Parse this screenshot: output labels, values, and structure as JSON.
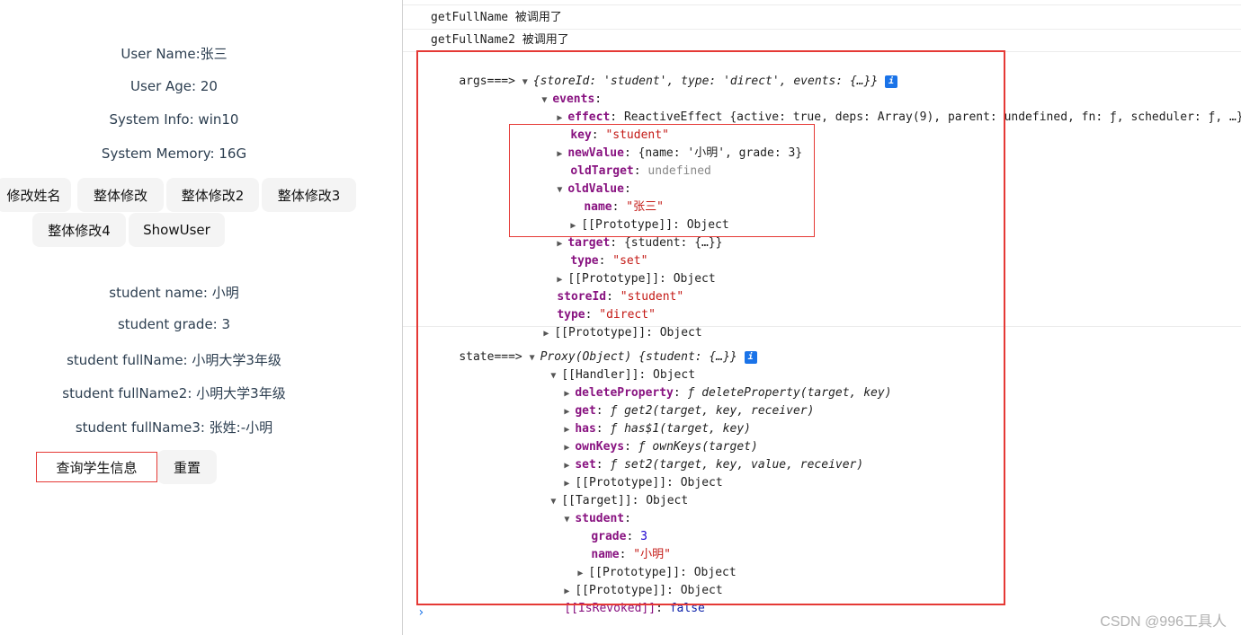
{
  "app": {
    "user_name": "User Name:张三",
    "user_age": "User Age: 20",
    "system_info": "System Info: win10",
    "system_memory": "System Memory: 16G",
    "buttons": {
      "modify_name": "修改姓名",
      "overall_modify": "整体修改",
      "overall_modify2": "整体修改2",
      "overall_modify3": "整体修改3",
      "overall_modify4": "整体修改4",
      "show_user": "ShowUser",
      "query_student": "查询学生信息",
      "reset": "重置"
    },
    "student_name": "student name: 小明",
    "student_grade": "student grade: 3",
    "student_fullname": "student fullName: 小明大学3年级",
    "student_fullname2": "student fullName2: 小明大学3年级",
    "student_fullname3": "student fullName3: 张姓:-小明"
  },
  "console": {
    "log1": "getFullName 被调用了",
    "log2": "getFullName2 被调用了",
    "args": {
      "label": "args===>",
      "summary": "{storeId: 'student', type: 'direct', events: {…}}",
      "events_key": "events",
      "effect_key": "effect",
      "effect_val": "ReactiveEffect {active: true, deps: Array(9), parent: undefined, fn: ƒ, scheduler: ƒ, …}",
      "key_key": "key",
      "key_val": "\"student\"",
      "newValue_key": "newValue",
      "newValue_val": "{name: '小明', grade: 3}",
      "oldTarget_key": "oldTarget",
      "oldTarget_val": "undefined",
      "oldValue_key": "oldValue",
      "name_key": "name",
      "name_val": "\"张三\"",
      "proto_text": "[[Prototype]]: Object",
      "target_key": "target",
      "target_val": "{student: {…}}",
      "type_key": "type",
      "type_val": "\"set\"",
      "storeId_key": "storeId",
      "storeId_val": "\"student\"",
      "type2_val": "\"direct\""
    },
    "state": {
      "label": "state===>",
      "summary": "Proxy(Object) {student: {…}}",
      "handler": "[[Handler]]: Object",
      "deleteProperty_key": "deleteProperty",
      "deleteProperty_val": "ƒ deleteProperty(target, key)",
      "get_key": "get",
      "get_val": "ƒ get2(target, key, receiver)",
      "has_key": "has",
      "has_val": "ƒ has$1(target, key)",
      "ownKeys_key": "ownKeys",
      "ownKeys_val": "ƒ ownKeys(target)",
      "set_key": "set",
      "set_val": "ƒ set2(target, key, value, receiver)",
      "proto_text": "[[Prototype]]: Object",
      "target_text": "[[Target]]: Object",
      "student_key": "student",
      "grade_key": "grade",
      "grade_val": "3",
      "name_key": "name",
      "name_val": "\"小明\"",
      "revoked_key": "[[IsRevoked]]",
      "revoked_val": "false"
    },
    "prompt": "›",
    "watermark": "CSDN @996工具人"
  }
}
